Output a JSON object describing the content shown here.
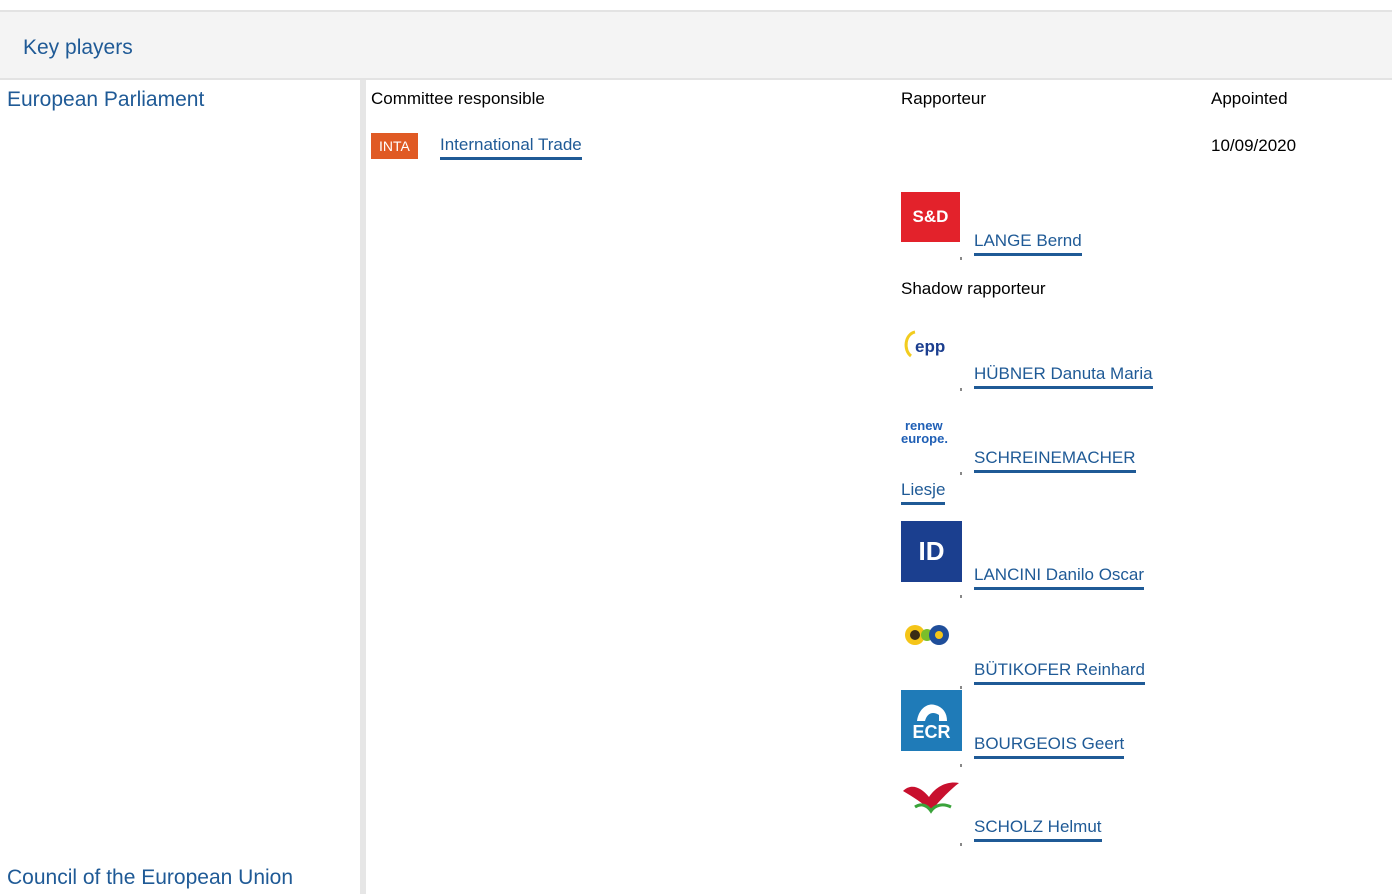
{
  "panel": {
    "title": "Key players"
  },
  "institutions": {
    "parliament": "European Parliament",
    "council": "Council of the European Union"
  },
  "columns": {
    "committee": "Committee responsible",
    "rapporteur": "Rapporteur",
    "appointed": "Appointed"
  },
  "committee": {
    "badge": "INTA",
    "name": "International Trade",
    "appointed_date": "10/09/2020",
    "badge_color": "#e05a24"
  },
  "rapporteur": {
    "group_logo_text": "S&D",
    "group_logo_icon": "sd-group-logo",
    "name": "LANGE Bernd",
    "color": "#e3222b"
  },
  "shadow_label": "Shadow rapporteur",
  "shadow_rapporteurs": [
    {
      "name": "HÜBNER Danuta Maria",
      "logo_text": "epp",
      "logo_icon": "epp-group-logo"
    },
    {
      "name_line1": "SCHREINEMACHER",
      "name_line2": "Liesje",
      "logo_text_1": "renew",
      "logo_text_2": "europe.",
      "logo_icon": "renew-europe-group-logo"
    },
    {
      "name": "LANCINI Danilo Oscar",
      "logo_text": "ID",
      "logo_icon": "id-group-logo"
    },
    {
      "name": "BÜTIKOFER Reinhard",
      "logo_icon": "greens-efa-group-logo"
    },
    {
      "name": "BOURGEOIS Geert",
      "logo_text": "ECR",
      "logo_icon": "ecr-group-logo"
    },
    {
      "name": "SCHOLZ Helmut",
      "logo_icon": "gue-ngl-group-logo"
    }
  ]
}
